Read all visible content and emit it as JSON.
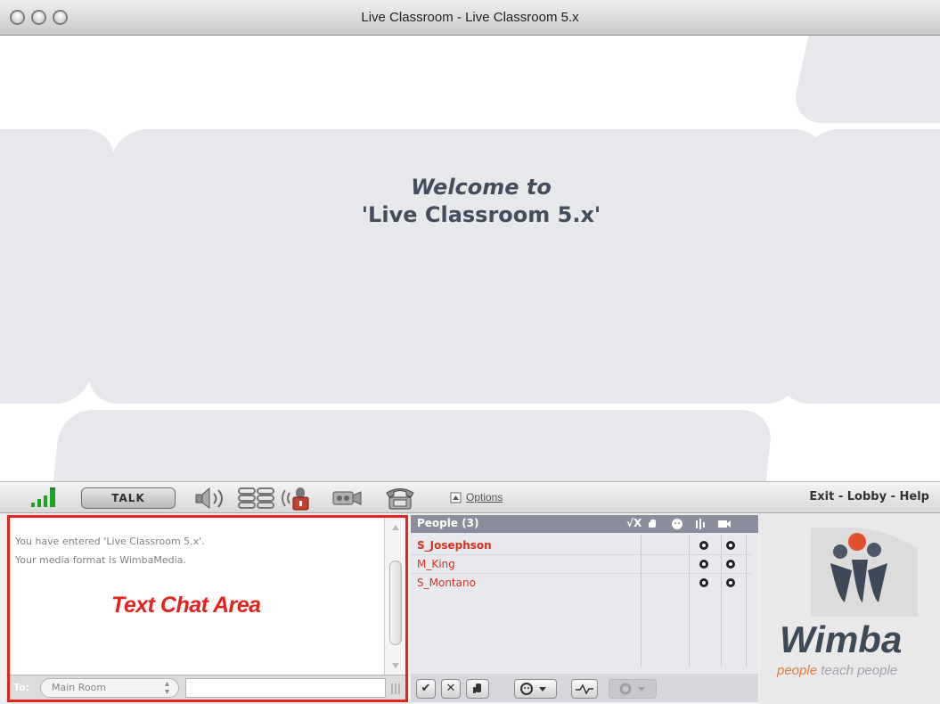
{
  "window": {
    "title": "Live Classroom - Live Classroom 5.x"
  },
  "stage": {
    "welcome_line1": "Welcome to",
    "welcome_line2": "'Live Classroom 5.x'"
  },
  "toolbar": {
    "talk_label": "TALK",
    "options_label": "Options",
    "exit_label": "Exit",
    "lobby_label": "Lobby",
    "help_label": "Help",
    "separator": " - ",
    "icons": [
      "signal-strength-icon",
      "speaker-icon",
      "talk-queue-icon",
      "mic-lock-icon",
      "video-camera-icon",
      "telephone-icon"
    ]
  },
  "chat": {
    "messages": [
      "You have entered 'Live Classroom 5.x'.",
      "Your media format is WimbaMedia."
    ],
    "area_label": "Text Chat Area",
    "to_label": "To:",
    "room_value": "Main Room",
    "input_value": ""
  },
  "people": {
    "title": "People (3)",
    "header_checks": "√X",
    "members": [
      {
        "name": "S_Josephson",
        "bold": true
      },
      {
        "name": "M_King",
        "bold": false
      },
      {
        "name": "S_Montano",
        "bold": false
      }
    ],
    "buttons": [
      "✔",
      "✕"
    ]
  },
  "logo": {
    "brand": "Wimba",
    "tag_highlight": "people",
    "tag_rest": " teach people"
  },
  "colors": {
    "accent_red": "#e4231d",
    "name_red": "#d3311f",
    "people_header": "#8a8d9b",
    "welcome_text": "#434d5b"
  }
}
